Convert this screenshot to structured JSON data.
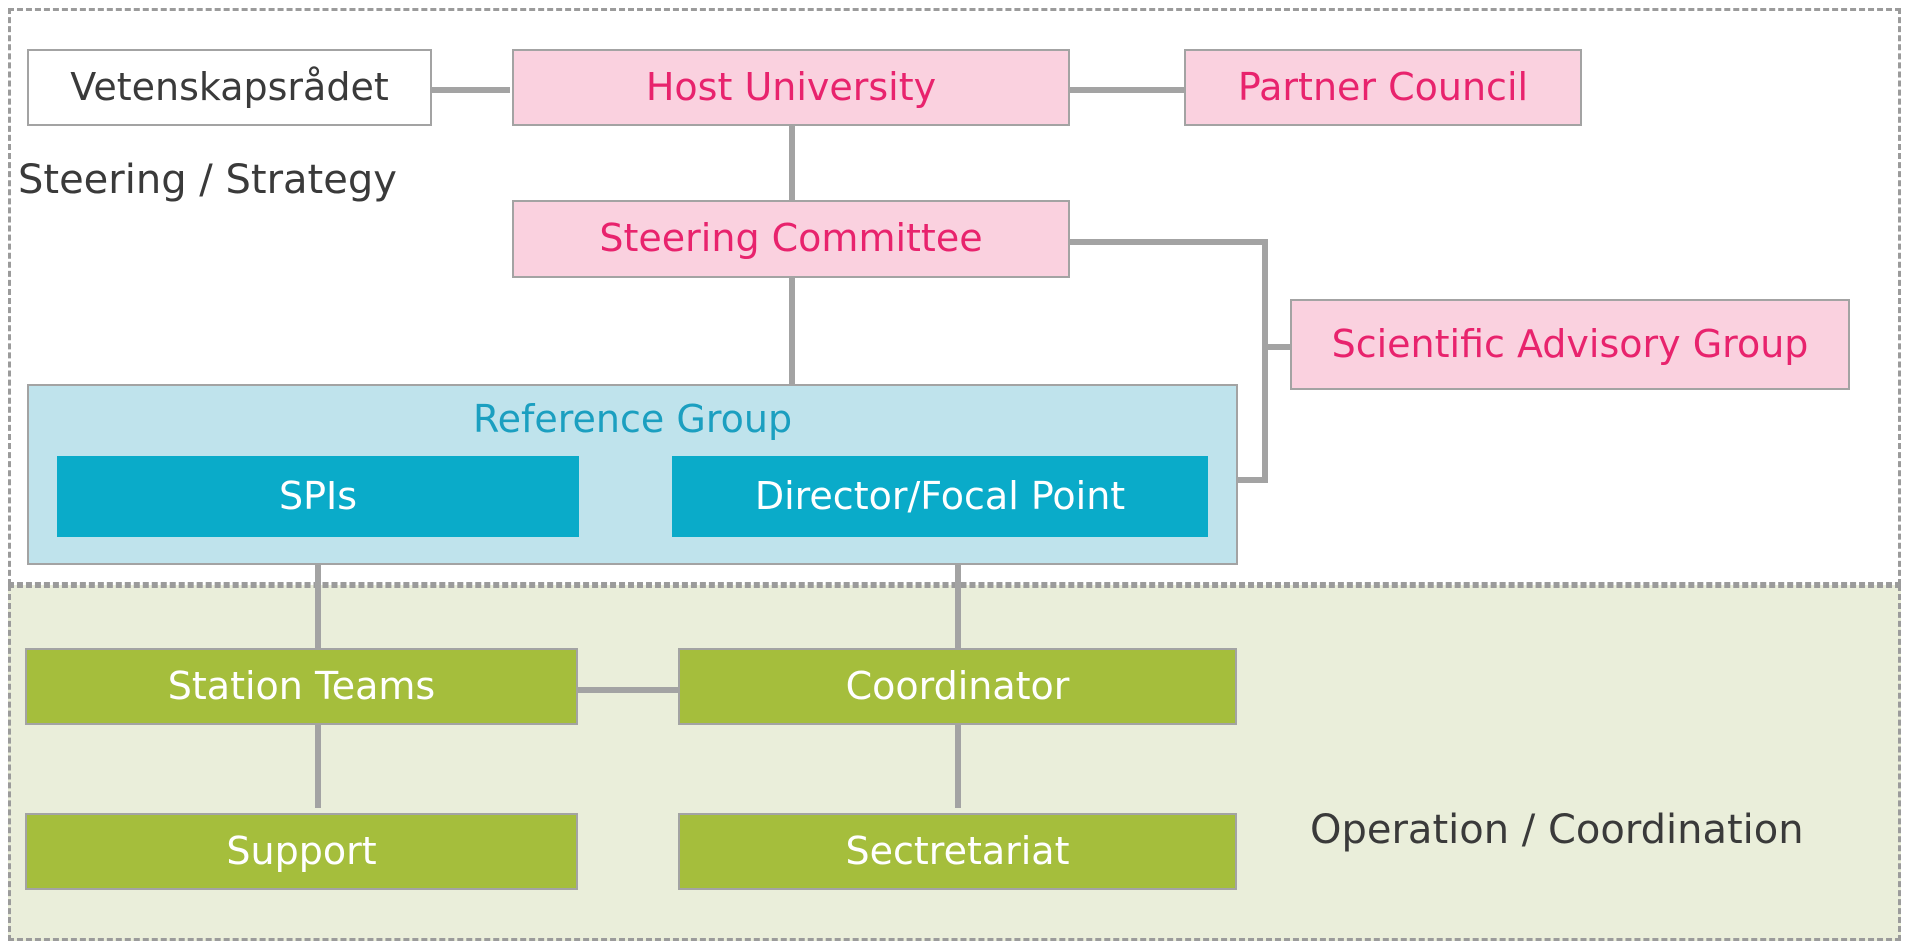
{
  "diagram": {
    "title_text": "",
    "zones": {
      "steering": {
        "caption": "Steering / Strategy",
        "fill": "transparent",
        "border": "#9b9b9b"
      },
      "operation": {
        "caption": "Operation / Coordination",
        "fill": "#eaeeda",
        "border": "#9b9b9b"
      }
    },
    "nodes": {
      "vetenskapsradet": {
        "label": "Vetenskapsrådet",
        "fill": "#ffffff",
        "text_color": "#3a3a3a"
      },
      "host_university": {
        "label": "Host University",
        "fill": "#fad1df",
        "text_color": "#e8236d"
      },
      "partner_council": {
        "label": "Partner Council",
        "fill": "#fad1df",
        "text_color": "#e8236d"
      },
      "steering_committee": {
        "label": "Steering Committee",
        "fill": "#fad1df",
        "text_color": "#e8236d"
      },
      "scientific_advisory_group": {
        "label": "Scientific Advisory Group",
        "fill": "#fad1df",
        "text_color": "#e8236d"
      },
      "reference_group": {
        "label": "Reference Group",
        "fill": "#bfe3ec",
        "text_color": "#1b9fc0"
      },
      "spis": {
        "label": "SPIs",
        "fill": "#0aabc9",
        "text_color": "#ffffff"
      },
      "director_focal_point": {
        "label": "Director/Focal Point",
        "fill": "#0aabc9",
        "text_color": "#ffffff"
      },
      "station_teams": {
        "label": "Station Teams",
        "fill": "#a5be3c",
        "text_color": "#ffffff"
      },
      "coordinator": {
        "label": "Coordinator",
        "fill": "#a5be3c",
        "text_color": "#ffffff"
      },
      "support": {
        "label": "Support",
        "fill": "#a5be3c",
        "text_color": "#ffffff"
      },
      "sectretariat": {
        "label": "Sectretariat",
        "fill": "#a5be3c",
        "text_color": "#ffffff"
      }
    },
    "connector_color": "#a3a3a3",
    "edges": [
      {
        "from": "vetenskapsradet",
        "to": "host_university"
      },
      {
        "from": "host_university",
        "to": "partner_council"
      },
      {
        "from": "host_university",
        "to": "steering_committee"
      },
      {
        "from": "steering_committee",
        "to": "reference_group"
      },
      {
        "from": "steering_committee",
        "to": "scientific_advisory_group"
      },
      {
        "from": "scientific_advisory_group",
        "to": "director_focal_point"
      },
      {
        "from": "spis",
        "to": "director_focal_point"
      },
      {
        "from": "spis",
        "to": "station_teams"
      },
      {
        "from": "director_focal_point",
        "to": "coordinator"
      },
      {
        "from": "station_teams",
        "to": "coordinator"
      },
      {
        "from": "station_teams",
        "to": "support"
      },
      {
        "from": "coordinator",
        "to": "sectretariat"
      }
    ]
  }
}
